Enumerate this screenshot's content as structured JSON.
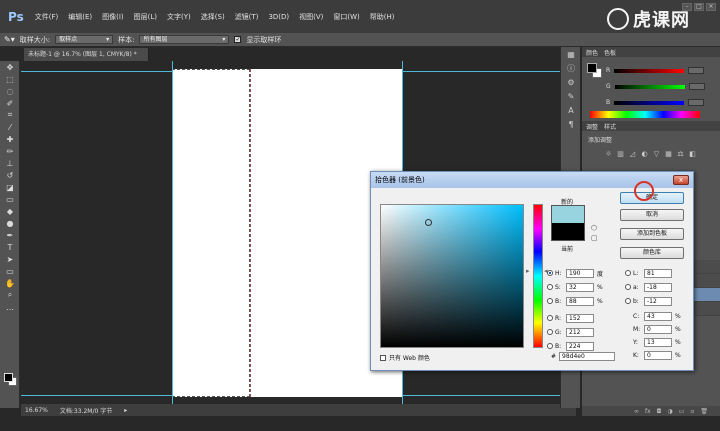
{
  "app": {
    "logo": "Ps"
  },
  "menu": [
    "文件(F)",
    "编辑(E)",
    "图像(I)",
    "图层(L)",
    "文字(Y)",
    "选择(S)",
    "滤镜(T)",
    "3D(D)",
    "视图(V)",
    "窗口(W)",
    "帮助(H)"
  ],
  "watermark": {
    "text": "虎课网"
  },
  "options_bar": {
    "sample_size_label": "取样大小:",
    "sample_size_value": "取样点",
    "sample_label": "样本:",
    "sample_value": "所有图层",
    "show_ring_label": "显示取样环"
  },
  "document": {
    "tab_title": "未标题-1 @ 16.7% (图层 1, CMYK/8) *"
  },
  "status": {
    "zoom": "16.67%",
    "doc_info": "文档:33.2M/0 字节"
  },
  "colors": {
    "new_color": "#98d4e0",
    "current_color": "#000000",
    "guide": "#4fb9d8"
  },
  "panels": {
    "color_tabs": [
      "颜色",
      "色板"
    ],
    "adjust_tabs": [
      "调整",
      "样式"
    ],
    "adjust_title": "添加调整",
    "rgb_labels": [
      "R",
      "G",
      "B"
    ]
  },
  "color_picker": {
    "title": "拾色器 (前景色)",
    "close": "x",
    "new_label": "新的",
    "current_label": "当前",
    "ok_button": "确定",
    "cancel_button": "取消",
    "add_swatch_button": "添加到色板",
    "libraries_button": "颜色库",
    "web_only_label": "只有 Web 颜色",
    "hex_label": "#",
    "hex": "98d4e0",
    "hsb": {
      "h": "190",
      "s": "32",
      "b": "88",
      "h_unit": "度",
      "pct": "%"
    },
    "rgb": {
      "r": "152",
      "g": "212",
      "b": "224"
    },
    "lab": {
      "l": "81",
      "a": "-18",
      "b": "-12"
    },
    "cmyk": {
      "c": "43",
      "m": "0",
      "y": "13",
      "k": "0",
      "pct": "%"
    },
    "labels": {
      "H": "H:",
      "S": "S:",
      "B": "B:",
      "R": "R:",
      "G": "G:",
      "B2": "B:",
      "L": "L:",
      "a": "a:",
      "b": "b:",
      "C": "C:",
      "M": "M:",
      "Y": "Y:",
      "K": "K:"
    }
  }
}
